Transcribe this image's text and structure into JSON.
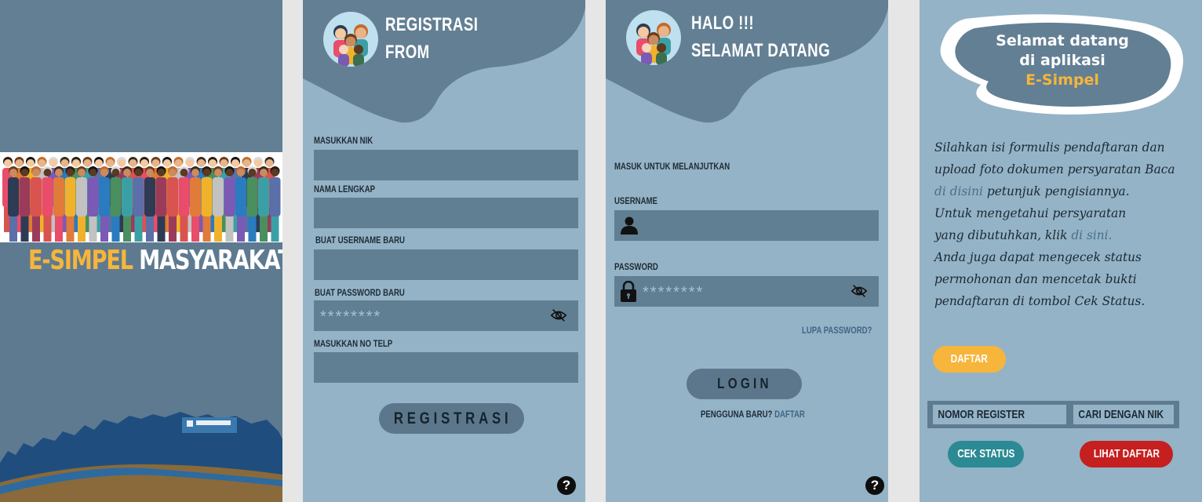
{
  "splash": {
    "brand_highlight": "E-SIMPEL",
    "brand_rest": "MASYARAKAT"
  },
  "register": {
    "title_line1": "REGISTRASI",
    "title_line2": "FROM",
    "nik_label": "MASUKKAN NIK",
    "name_label": "NAMA LENGKAP",
    "username_label": "BUAT USERNAME BARU",
    "password_label": "BUAT PASSWORD BARU",
    "password_mask": "********",
    "phone_label": "MASUKKAN NO TELP",
    "submit_label": "REGISTRASI",
    "help_label": "?"
  },
  "login": {
    "title_line1": "HALO !!!",
    "title_line2": "SELAMAT DATANG",
    "subtitle": "MASUK UNTUK MELANJUTKAN",
    "username_label": "USERNAME",
    "password_label": "PASSWORD",
    "password_mask": "********",
    "forgot_label": "LUPA PASSWORD?",
    "submit_label": "LOGIN",
    "new_user_text": "PENGGUNA BARU?",
    "register_link": "DAFTAR",
    "help_label": "?"
  },
  "info": {
    "welcome_line1": "Selamat datang",
    "welcome_line2": "di aplikasi",
    "welcome_line3": "E-Simpel",
    "desc_1": "Silahkan isi formulis pendaftaran dan",
    "desc_2": "upload foto dokumen persyaratan Baca",
    "desc_3_link": "di disini",
    "desc_3_rest": " petunjuk pengisiannya.",
    "desc_4": "Untuk mengetahui persyaratan",
    "desc_5": "yang dibutuhkan, klik ",
    "desc_5_link": "di sini.",
    "desc_6": "Anda juga dapat mengecek status",
    "desc_7": "permohonan dan mencetak bukti",
    "desc_8": "pendaftaran di tombol Cek Status.",
    "daftar_button": "DAFTAR",
    "register_number_placeholder": "NOMOR REGISTER",
    "nik_search_label": "CARI DENGAN NIK",
    "check_status_button": "CEK STATUS",
    "view_list_button": "LIHAT DAFTAR"
  },
  "colors": {
    "dark_slate": "#5e7a90",
    "light_slate": "#94b3c6",
    "accent_yellow": "#f6b53b",
    "teal_button": "#2b8a93",
    "red_button": "#c51f1f"
  }
}
